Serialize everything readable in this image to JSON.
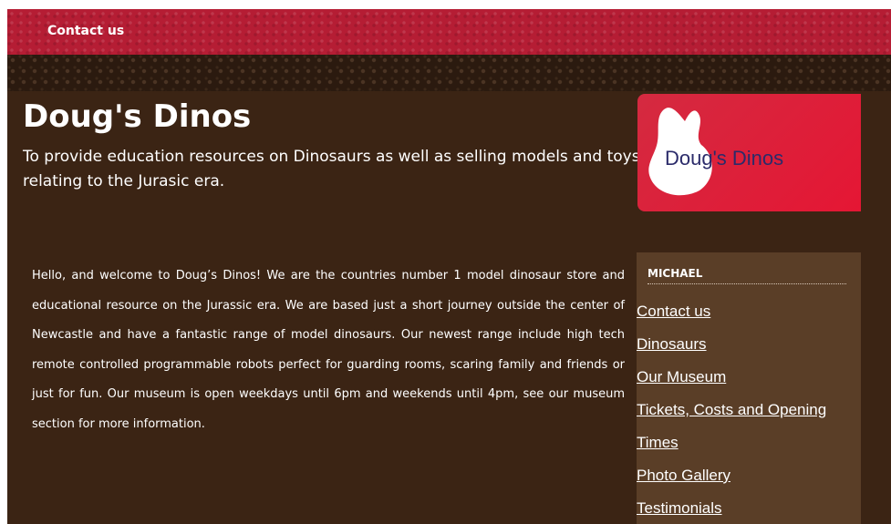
{
  "nav": {
    "contact": "Contact us"
  },
  "site": {
    "title": "Doug's Dinos",
    "tagline": "To provide education resources on Dinosaurs as well as selling models and toys relating to the Jurasic era.",
    "logo_text": "Doug's Dinos"
  },
  "intro": "Hello, and welcome to Doug’s Dinos! We are the countries number 1 model dinosaur store and educational resource on the Jurassic era. We are based just a short journey outside the center of Newcastle and have a fantastic range of model dinosaurs. Our newest range include high tech remote controlled programmable robots perfect for guarding rooms, scaring family and friends or just for fun. Our museum is open weekdays until 6pm and weekends until 4pm, see our museum section for more information.",
  "sidebar": {
    "title": "MICHAEL",
    "links": [
      {
        "label": "Contact us"
      },
      {
        "label": "Dinosaurs"
      },
      {
        "label": "Our Museum"
      },
      {
        "label": "Tickets, Costs and Opening"
      },
      {
        "label": "Times"
      },
      {
        "label": "Photo Gallery"
      },
      {
        "label": "Testimonials"
      }
    ]
  },
  "colors": {
    "header_red": "#b51d34",
    "page_brown": "#3b2414",
    "sidebar_brown": "#5a3e27",
    "logo_red": "#e51634"
  }
}
